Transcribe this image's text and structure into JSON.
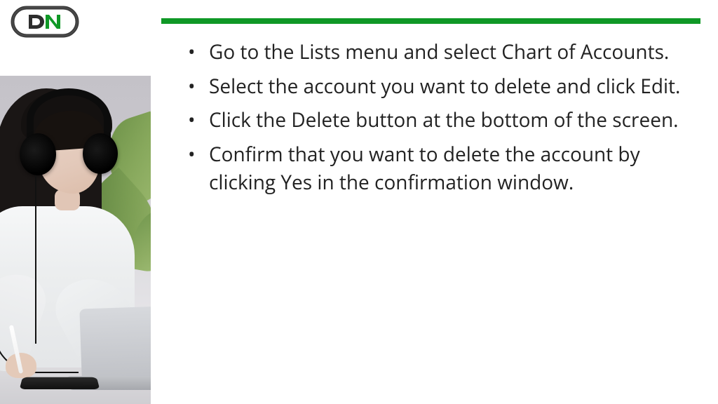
{
  "brand": {
    "accent": "#0f9826"
  },
  "steps": {
    "items": [
      "Go to the Lists menu and select Chart of Accounts.",
      "Select the account you want to delete and click Edit.",
      "Click the Delete button at the bottom of the screen.",
      "Confirm that you want to delete the account by clicking Yes in the confirmation window."
    ]
  }
}
